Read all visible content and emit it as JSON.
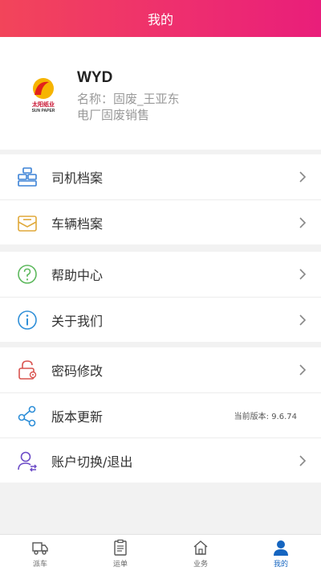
{
  "header": {
    "title": "我的"
  },
  "profile": {
    "logo_text": [
      "太阳纸业",
      "SUN PAPER"
    ],
    "name": "WYD",
    "line1": "名称：固废_王亚东",
    "line2": "电厂固废销售"
  },
  "menu": {
    "driver_files": "司机档案",
    "vehicle_files": "车辆档案",
    "help_center": "帮助中心",
    "about_us": "关于我们",
    "change_password": "密码修改",
    "version_update": "版本更新",
    "current_version": "当前版本: 9.6.74",
    "switch_account": "账户切换/退出"
  },
  "tabbar": {
    "dispatch": "派车",
    "waybill": "运单",
    "business": "业务",
    "mine": "我的"
  },
  "colors": {
    "header_start": "#f2455a",
    "header_end": "#e91e7a",
    "active_tab": "#1565c0"
  }
}
